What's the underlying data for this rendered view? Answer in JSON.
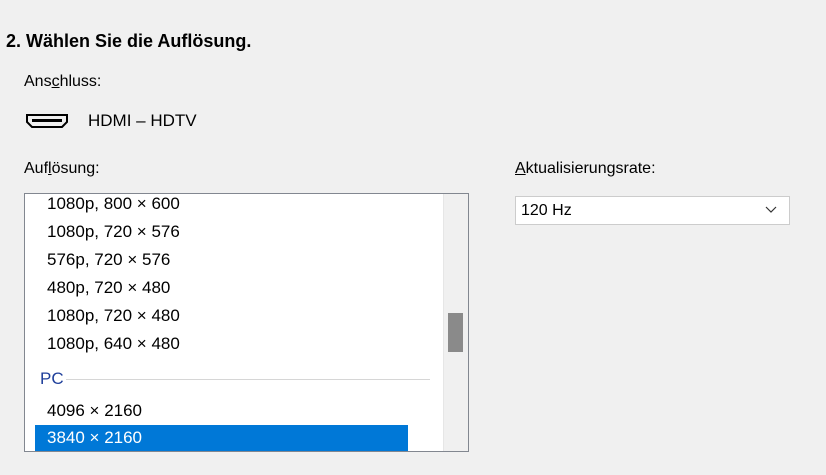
{
  "section": {
    "title": "2. Wählen Sie die Auflösung."
  },
  "connector": {
    "label_pre": "Ans",
    "label_accel": "c",
    "label_post": "hluss:",
    "icon": "hdmi-icon",
    "name": "HDMI – HDTV"
  },
  "resolution": {
    "label_pre": "Auf",
    "label_accel": "l",
    "label_post": "ösung:",
    "items": [
      "1080p, 800 × 600",
      "1080p, 720 × 576",
      "576p, 720 × 576",
      "480p, 720 × 480",
      "1080p, 720 × 480",
      "1080p, 640 × 480"
    ],
    "group_header": "PC",
    "pc_items": [
      "4096 × 2160",
      "3840 × 2160"
    ],
    "selected": "3840 × 2160"
  },
  "refresh": {
    "label_pre": "",
    "label_accel": "A",
    "label_post": "ktualisierungsrate:",
    "value": "120 Hz",
    "icon": "chevron-down-icon"
  },
  "colors": {
    "selection": "#0078d7",
    "group_header": "#1f3f9b",
    "background": "#f0f0f0"
  }
}
